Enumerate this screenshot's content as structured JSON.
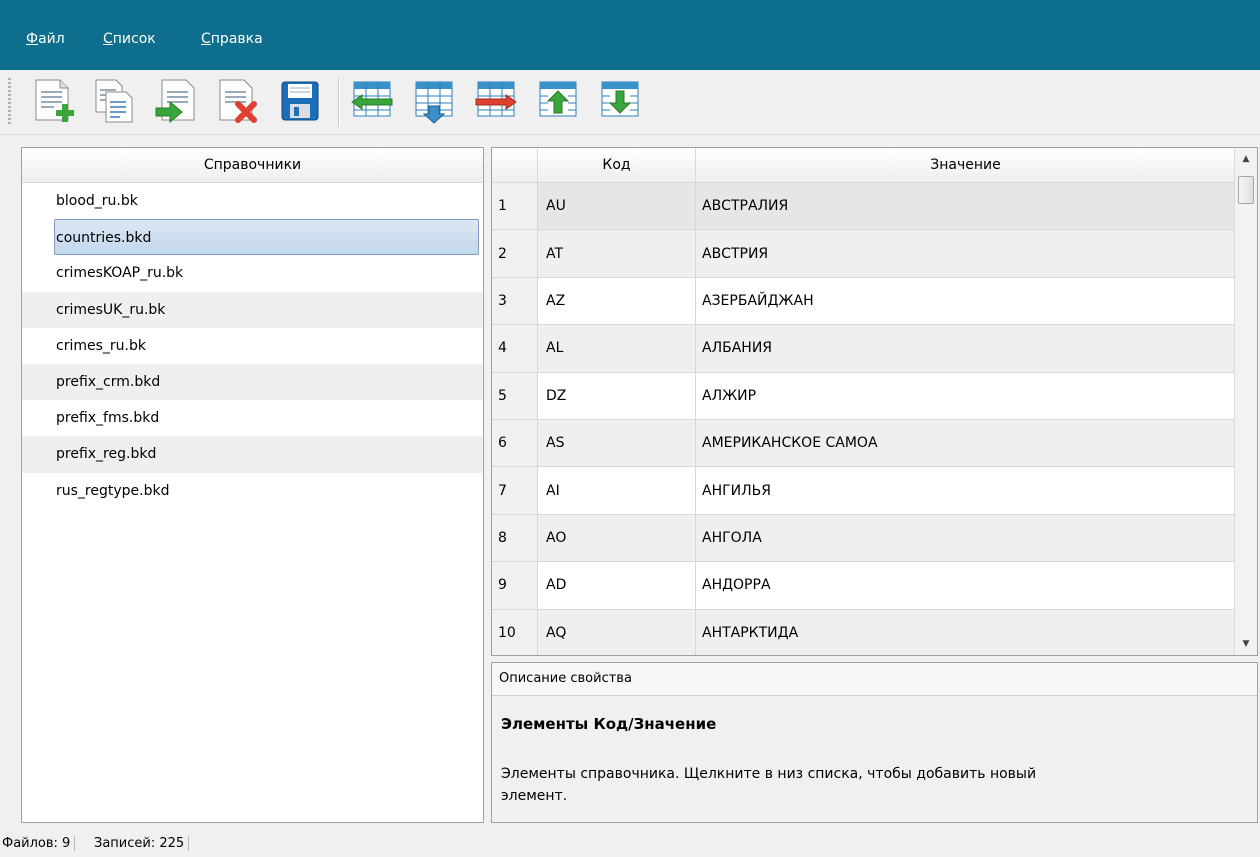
{
  "menu": {
    "file": {
      "accel": "Ф",
      "rest": "айл"
    },
    "list": {
      "accel": "С",
      "rest": "писок"
    },
    "help": {
      "accel": "С",
      "rest": "правка"
    }
  },
  "toolbar": {
    "buttons": [
      "new-file-icon",
      "copy-file-icon",
      "import-file-icon",
      "delete-file-icon",
      "save-icon",
      "insert-row-icon",
      "add-row-icon",
      "remove-row-icon",
      "move-row-up-icon",
      "move-row-down-icon"
    ]
  },
  "left_panel": {
    "header": "Справочники",
    "files": [
      "blood_ru.bk",
      "countries.bkd",
      "crimesKOAP_ru.bk",
      "crimesUK_ru.bk",
      "crimes_ru.bk",
      "prefix_crm.bkd",
      "prefix_fms.bkd",
      "prefix_reg.bkd",
      "rus_regtype.bkd"
    ],
    "selected_index": 1
  },
  "table": {
    "headers": {
      "code": "Код",
      "value": "Значение"
    },
    "rows": [
      {
        "num": "1",
        "code": "AU",
        "value": "АВСТРАЛИЯ"
      },
      {
        "num": "2",
        "code": "AT",
        "value": "АВСТРИЯ"
      },
      {
        "num": "3",
        "code": "AZ",
        "value": "АЗЕРБАЙДЖАН"
      },
      {
        "num": "4",
        "code": "AL",
        "value": "АЛБАНИЯ"
      },
      {
        "num": "5",
        "code": "DZ",
        "value": "АЛЖИР"
      },
      {
        "num": "6",
        "code": "AS",
        "value": "АМЕРИКАНСКОЕ САМОА"
      },
      {
        "num": "7",
        "code": "AI",
        "value": "АНГИЛЬЯ"
      },
      {
        "num": "8",
        "code": "AO",
        "value": "АНГОЛА"
      },
      {
        "num": "9",
        "code": "AD",
        "value": "АНДОРРА"
      },
      {
        "num": "10",
        "code": "AQ",
        "value": "АНТАРКТИДА"
      }
    ]
  },
  "description": {
    "header": "Описание свойства",
    "title": "Элементы Код/Значение",
    "text": "Элементы справочника. Щелкните в низ списка, чтобы добавить новый элемент."
  },
  "status": {
    "files": "Файлов: 9",
    "records": "Записей: 225"
  },
  "colors": {
    "menubar": "#0e6e8e",
    "selection": "#c4d7ec"
  }
}
